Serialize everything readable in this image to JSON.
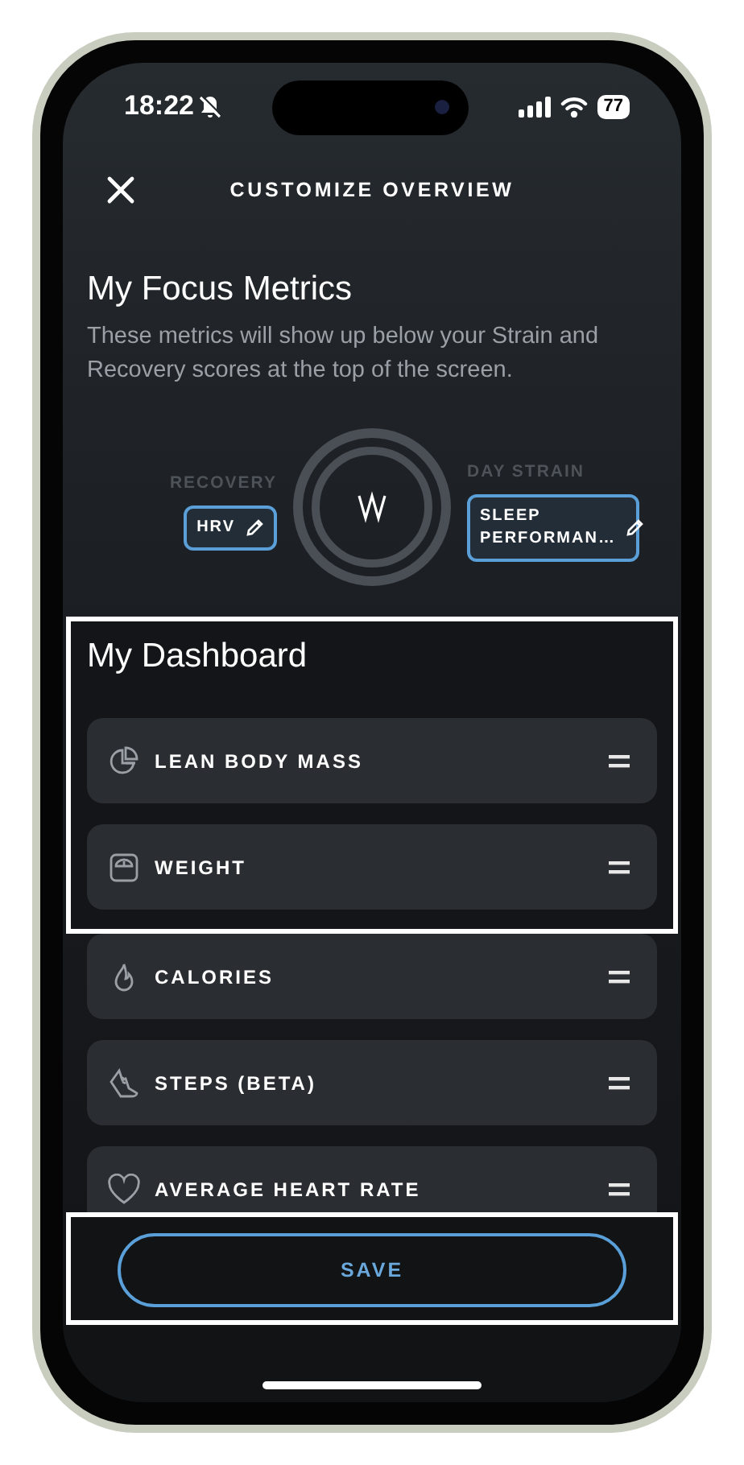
{
  "status_bar": {
    "time": "18:22",
    "silent": true,
    "battery": "77"
  },
  "header": {
    "title": "CUSTOMIZE OVERVIEW"
  },
  "focus": {
    "title": "My Focus Metrics",
    "description": "These metrics will show up below your Strain and Recovery scores at the top of the screen.",
    "left": {
      "label": "RECOVERY",
      "metric": "HRV"
    },
    "right": {
      "label": "DAY STRAIN",
      "metric": "SLEEP PERFORMAN…"
    }
  },
  "dashboard": {
    "title": "My Dashboard",
    "items": [
      {
        "label": "LEAN BODY MASS",
        "kind": "body",
        "highlighted": true
      },
      {
        "label": "WEIGHT",
        "kind": "scale",
        "highlighted": true
      },
      {
        "label": "CALORIES",
        "kind": "flame",
        "highlighted": false
      },
      {
        "label": "STEPS (BETA)",
        "kind": "shoe",
        "highlighted": false
      },
      {
        "label": "AVERAGE HEART RATE",
        "kind": "heart",
        "highlighted": false
      }
    ]
  },
  "save": {
    "label": "SAVE",
    "highlighted": true
  }
}
